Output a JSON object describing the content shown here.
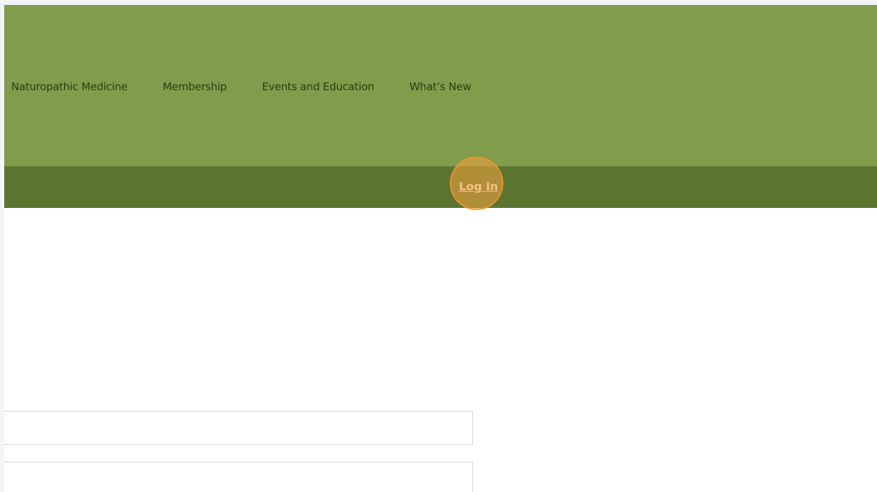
{
  "nav": {
    "items": [
      {
        "label": "Naturopathic Medicine"
      },
      {
        "label": "Membership"
      },
      {
        "label": "Events and Education"
      },
      {
        "label": "What’s New"
      }
    ]
  },
  "login_bar": {
    "link_label": "Log In"
  },
  "form": {
    "field_1": {
      "value": "",
      "placeholder": ""
    },
    "field_2": {
      "value": "",
      "placeholder": ""
    }
  },
  "colors": {
    "header_bg": "#819d4c",
    "login_bar_bg": "#5b7531",
    "nav_text": "#2b3a18",
    "login_text": "#efeede",
    "click_marker": "#f5a03c"
  }
}
